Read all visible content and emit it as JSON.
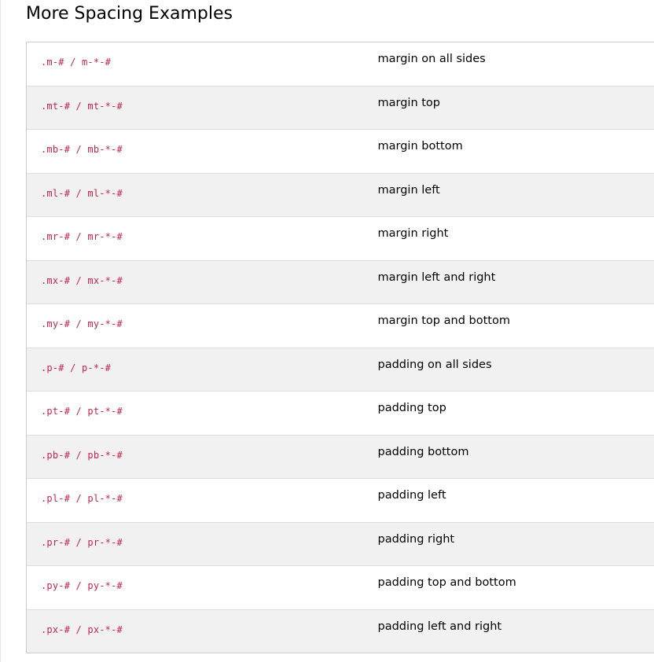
{
  "section": {
    "title": "More Spacing Examples"
  },
  "rows": [
    {
      "cls": ".m-# / m-*-#",
      "desc": "margin on all sides"
    },
    {
      "cls": ".mt-# / mt-*-#",
      "desc": "margin top"
    },
    {
      "cls": ".mb-# / mb-*-#",
      "desc": "margin bottom"
    },
    {
      "cls": ".ml-# / ml-*-#",
      "desc": "margin left"
    },
    {
      "cls": ".mr-# / mr-*-#",
      "desc": "margin right"
    },
    {
      "cls": ".mx-# / mx-*-#",
      "desc": "margin left and right"
    },
    {
      "cls": ".my-# / my-*-#",
      "desc": "margin top and bottom"
    },
    {
      "cls": ".p-# / p-*-#",
      "desc": "padding on all sides"
    },
    {
      "cls": ".pt-# / pt-*-#",
      "desc": "padding top"
    },
    {
      "cls": ".pb-# / pb-*-#",
      "desc": "padding bottom"
    },
    {
      "cls": ".pl-# / pl-*-#",
      "desc": "padding left"
    },
    {
      "cls": ".pr-# / pr-*-#",
      "desc": "padding right"
    },
    {
      "cls": ".py-# / py-*-#",
      "desc": "padding top and bottom"
    },
    {
      "cls": ".px-# / px-*-#",
      "desc": "padding left and right"
    }
  ],
  "colors": {
    "code_text": "#c7254e",
    "stripe": "#f1f1f1",
    "border": "#dddddd"
  }
}
